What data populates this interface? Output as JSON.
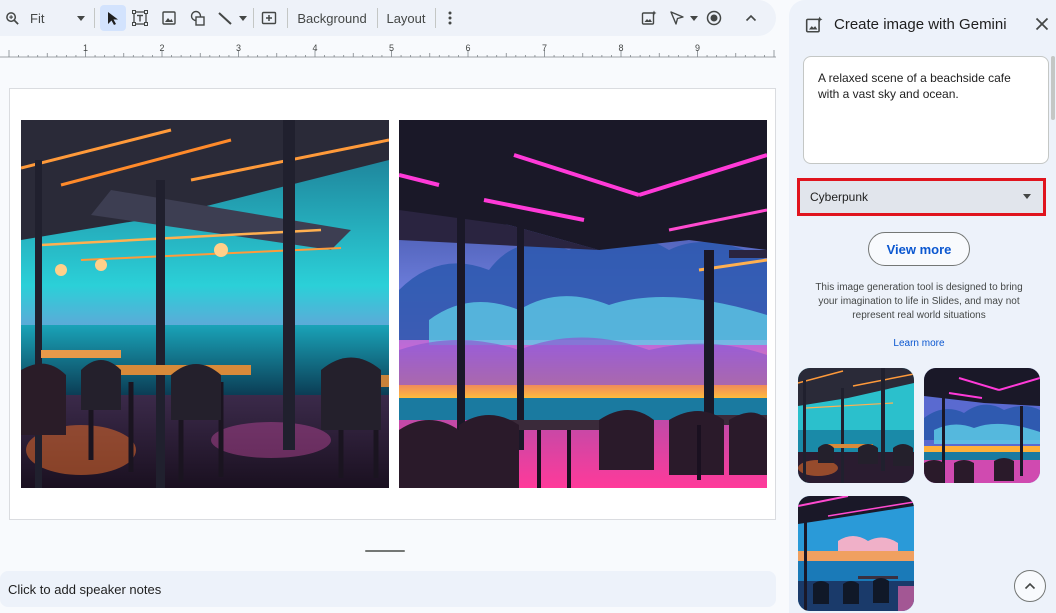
{
  "toolbar": {
    "zoom_label": "Fit",
    "background_label": "Background",
    "layout_label": "Layout"
  },
  "ruler": {
    "numbers": [
      "1",
      "2",
      "3",
      "4",
      "5",
      "6",
      "7",
      "8",
      "9"
    ]
  },
  "notes": {
    "placeholder": "Click to add speaker notes"
  },
  "panel": {
    "title": "Create image with Gemini",
    "prompt_text": "A relaxed scene of a beachside cafe with a vast sky and ocean.",
    "style_selected": "Cyberpunk",
    "view_more_label": "View more",
    "disclaimer": "This image generation tool is designed to bring your imagination to life in Slides, and may not represent real world situations",
    "learn_more_label": "Learn more",
    "thumbnails": [
      "cyberpunk-cafe-1",
      "cyberpunk-cafe-2",
      "cyberpunk-cafe-3"
    ]
  },
  "colors": {
    "accent": "#0b57d0",
    "highlight_border": "#e0141e",
    "toolbar_bg": "#eef2f9",
    "panel_bg": "#edf2fa"
  },
  "icons": {
    "zoom": "zoom-icon",
    "select": "select-cursor-icon",
    "text_box": "text-box-icon",
    "image": "image-icon",
    "shape": "shape-icon",
    "line": "line-icon",
    "new_slide": "new-slide-icon",
    "more": "more-vert-icon",
    "gemini_image": "gemini-image-icon",
    "pointer": "laser-pointer-icon",
    "record": "record-icon",
    "collapse": "chevron-up-icon",
    "close": "close-icon"
  }
}
